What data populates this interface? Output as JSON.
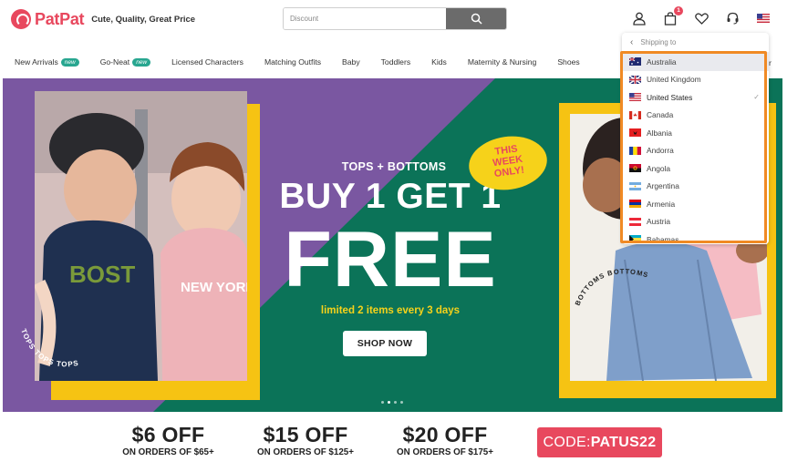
{
  "brand": {
    "name": "PatPat",
    "tagline": "Cute, Quality, Great Price"
  },
  "search": {
    "placeholder": "Discount"
  },
  "header": {
    "cart_count": "1"
  },
  "nav": {
    "items": [
      {
        "label": "New Arrivals",
        "badge": "new"
      },
      {
        "label": "Go-Neat",
        "badge": "new"
      },
      {
        "label": "Licensed Characters"
      },
      {
        "label": "Matching Outfits"
      },
      {
        "label": "Baby"
      },
      {
        "label": "Toddlers"
      },
      {
        "label": "Kids"
      },
      {
        "label": "Maternity & Nursing"
      },
      {
        "label": "Shoes"
      }
    ],
    "cut_label": "r"
  },
  "hero": {
    "kicker": "TOPS + BOTTOMS",
    "headline": "BUY 1 GET 1",
    "headline_big": "FREE",
    "subline": "limited 2 items every 3 days",
    "cta": "SHOP NOW",
    "sticker": [
      "THIS",
      "WEEK",
      "ONLY!"
    ],
    "slides": 4,
    "active_slide": 1,
    "colors": {
      "purple": "#7a57a1",
      "green": "#0b7358",
      "yellow": "#f6c313"
    },
    "left_sticker_text": "TOPS TOPS TOPS TOPS TOPS",
    "right_sticker_text": "BOTTOMS BOTTOMS BOTTOMS"
  },
  "promos": [
    {
      "amount": "$6 OFF",
      "condition": "ON ORDERS OF $65+"
    },
    {
      "amount": "$15 OFF",
      "condition": "ON ORDERS OF $125+"
    },
    {
      "amount": "$20 OFF",
      "condition": "ON ORDERS OF $175+"
    }
  ],
  "code": {
    "label": "CODE:",
    "value": "PATUS22"
  },
  "shipping": {
    "title": "Shipping to",
    "countries": [
      {
        "name": "Australia",
        "state": "hover"
      },
      {
        "name": "United Kingdom"
      },
      {
        "name": "United States",
        "state": "selected"
      },
      {
        "name": "Canada"
      },
      {
        "name": "Albania"
      },
      {
        "name": "Andorra"
      },
      {
        "name": "Angola"
      },
      {
        "name": "Argentina"
      },
      {
        "name": "Armenia"
      },
      {
        "name": "Austria"
      },
      {
        "name": "Bahamas"
      }
    ]
  },
  "accent_colors": {
    "brand": "#e8485e",
    "highlight": "#f08a24"
  }
}
